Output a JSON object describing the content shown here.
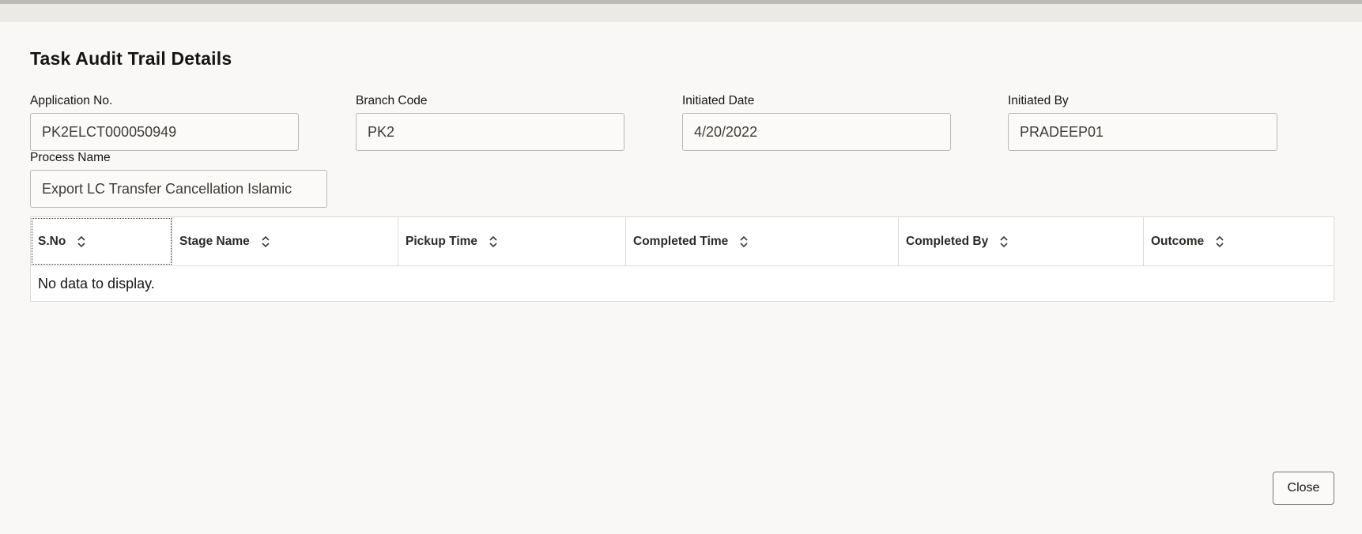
{
  "dialog": {
    "title": "Task Audit Trail Details",
    "fields": {
      "application_no": {
        "label": "Application No.",
        "value": "PK2ELCT000050949"
      },
      "branch_code": {
        "label": "Branch Code",
        "value": "PK2"
      },
      "initiated_date": {
        "label": "Initiated Date",
        "value": "4/20/2022"
      },
      "initiated_by": {
        "label": "Initiated By",
        "value": "PRADEEP01"
      },
      "process_name": {
        "label": "Process Name",
        "value": "Export LC Transfer Cancellation Islamic"
      }
    },
    "table": {
      "columns": [
        "S.No",
        "Stage Name",
        "Pickup Time",
        "Completed Time",
        "Completed By",
        "Outcome"
      ],
      "empty_message": "No data to display."
    },
    "close_label": "Close"
  },
  "icons": {
    "sort": "sort-up-down-icon"
  }
}
